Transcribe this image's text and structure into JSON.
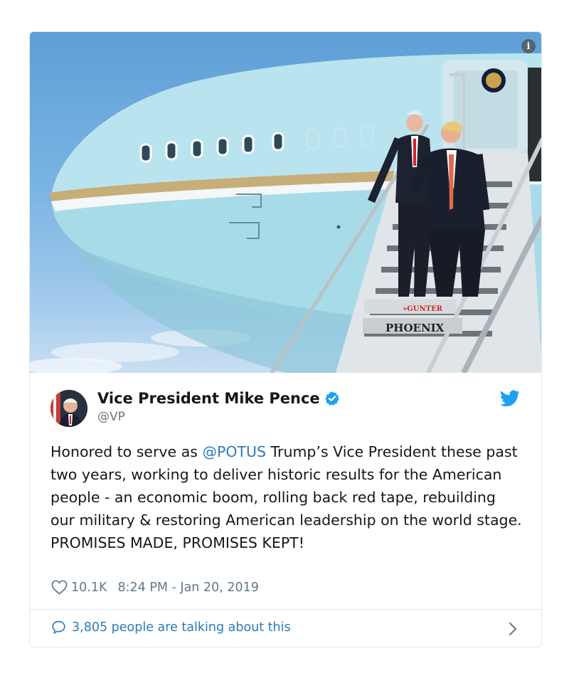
{
  "media": {
    "info_icon": "info-icon",
    "stair_sign_top": "»GUNTER",
    "stair_sign_bottom": "PHOENIX"
  },
  "author": {
    "display_name": "Vice President Mike Pence",
    "handle": "@VP",
    "verified": true,
    "verified_color": "#1da1f2"
  },
  "tweet": {
    "text_before": "Honored to serve as ",
    "mention": "@POTUS",
    "text_after": " Trump’s Vice President these past two years, working to deliver historic results for the American people - an economic boom, rolling back red tape, rebuilding our military & restoring American leadership on the world stage. PROMISES MADE, PROMISES KEPT!",
    "likes": "10.1K",
    "timestamp": "8:24 PM - Jan 20, 2019"
  },
  "footer": {
    "talking": "3,805 people are talking about this"
  },
  "colors": {
    "link": "#2b7bb9",
    "muted": "#657786",
    "twitter_blue": "#1da1f2",
    "border": "#e1e8ed"
  },
  "icons": [
    "info-icon",
    "verified-badge-icon",
    "twitter-bird-icon",
    "heart-icon",
    "speech-bubble-icon",
    "chevron-right-icon"
  ]
}
